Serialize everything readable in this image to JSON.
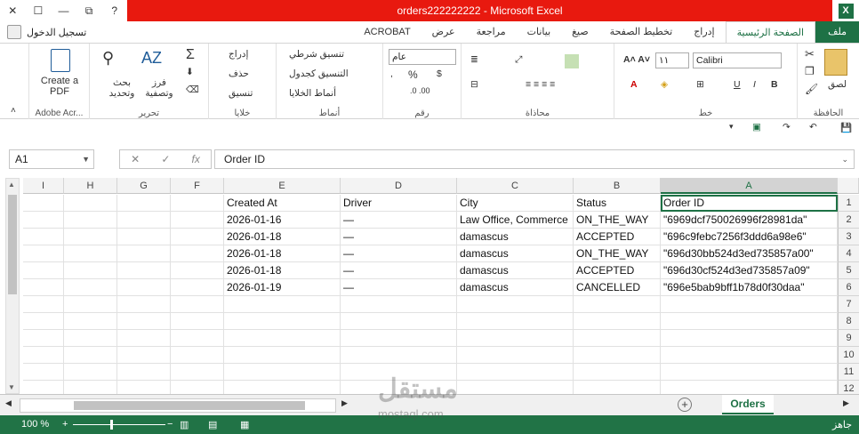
{
  "window": {
    "title": "orders222222222  -  Microsoft Excel",
    "app_badge": "X"
  },
  "tabs": [
    {
      "label": "ملف",
      "kind": "file"
    },
    {
      "label": "الصفحة الرئيسية",
      "kind": "active"
    },
    {
      "label": "إدراج"
    },
    {
      "label": "تخطيط الصفحة"
    },
    {
      "label": "صيغ"
    },
    {
      "label": "بيانات"
    },
    {
      "label": "مراجعة"
    },
    {
      "label": "عرض"
    },
    {
      "label": "ACROBAT"
    }
  ],
  "signin": "تسجيل الدخول",
  "ribbon": {
    "clipboard": {
      "group": "الحافظة",
      "paste": "لصق"
    },
    "font": {
      "group": "خط",
      "name": "Calibri",
      "size": "١١"
    },
    "alignment": {
      "group": "محاذاة"
    },
    "number": {
      "group": "رقم",
      "format": "عام",
      "percent": "%"
    },
    "styles": {
      "group": "أنماط",
      "cond": "تنسيق شرطي",
      "table": "التنسيق كجدول",
      "cell": "أنماط الخلايا"
    },
    "cells": {
      "group": "خلايا",
      "insert": "إدراج",
      "delete": "حذف",
      "format": "تنسيق"
    },
    "editing": {
      "group": "تحرير",
      "sort": "فرز وتصفية",
      "find": "بحث وتحديد"
    },
    "adobe": {
      "group": "Adobe Acr...",
      "create": "Create a PDF"
    }
  },
  "namebox": "A1",
  "formula": "Order ID",
  "columns": [
    {
      "id": "A",
      "selected": true
    },
    {
      "id": "B"
    },
    {
      "id": "C"
    },
    {
      "id": "D"
    },
    {
      "id": "E"
    },
    {
      "id": "F"
    },
    {
      "id": "G"
    },
    {
      "id": "H"
    },
    {
      "id": "I"
    }
  ],
  "rows": [
    "1",
    "2",
    "3",
    "4",
    "5",
    "6",
    "7",
    "8",
    "9",
    "10",
    "11",
    "12"
  ],
  "table": [
    [
      "Order ID",
      "Status",
      "City",
      "Driver",
      "Created At"
    ],
    [
      "\"6969dcf750026996f28981da\"",
      "ON_THE_WAY",
      "Law Office, Commerce",
      "—",
      "2026-01-16"
    ],
    [
      "\"696c9febc7256f3ddd6a98e6\"",
      "ACCEPTED",
      "damascus",
      "—",
      "2026-01-18"
    ],
    [
      "\"696d30bb524d3ed735857a00\"",
      "ON_THE_WAY",
      "damascus",
      "—",
      "2026-01-18"
    ],
    [
      "\"696d30cf524d3ed735857a09\"",
      "ACCEPTED",
      "damascus",
      "—",
      "2026-01-18"
    ],
    [
      "\"696e5bab9bff1b78d0f30daa\"",
      "CANCELLED",
      "damascus",
      "—",
      "2026-01-19"
    ]
  ],
  "sheet_tab": "Orders",
  "status": {
    "ready": "جاهز",
    "zoom": "100 %"
  },
  "watermark": {
    "main": "مستقل",
    "sub": "mostaql.com"
  },
  "colors": {
    "excel_green": "#217346",
    "title_red": "#e8190f"
  }
}
